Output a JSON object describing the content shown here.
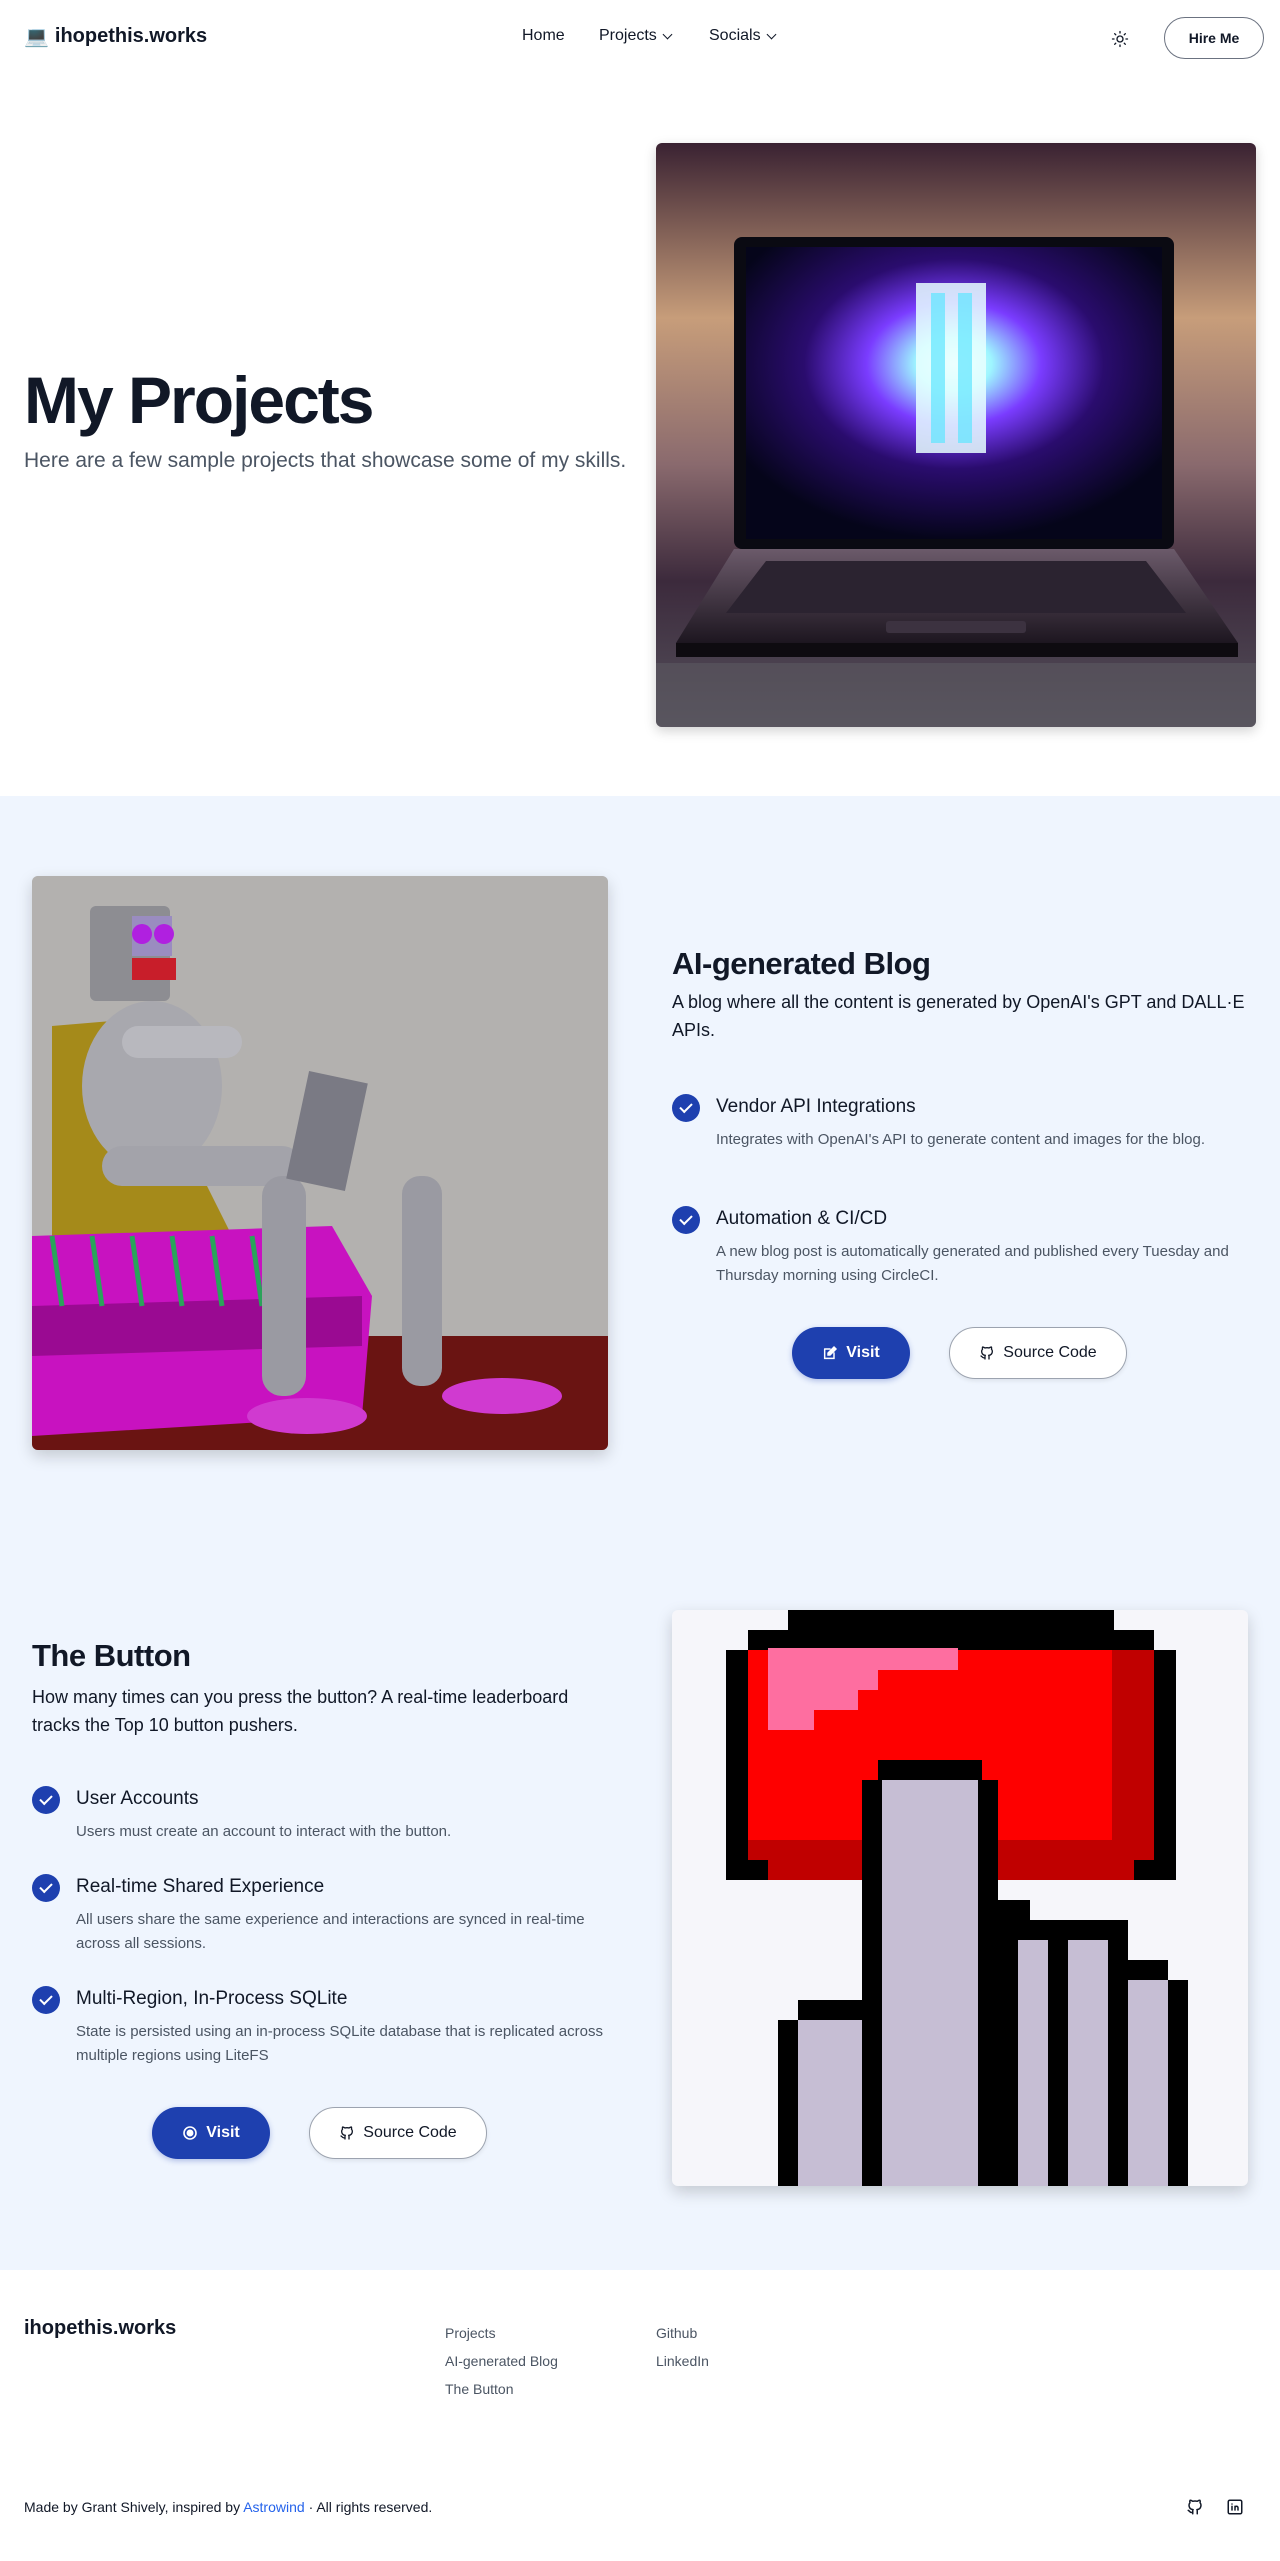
{
  "header": {
    "logo_emoji": "💻",
    "logo_text": "ihopethis.works",
    "nav": {
      "home": "Home",
      "projects": "Projects",
      "socials": "Socials"
    },
    "theme_icon": "sun-icon",
    "hire_label": "Hire Me"
  },
  "hero": {
    "title": "My Projects",
    "subtitle": "Here are a few sample projects that showcase some of my skills."
  },
  "projects": [
    {
      "title": "AI-generated Blog",
      "description": "A blog where all the content is generated by OpenAI's GPT and DALL·E APIs.",
      "features": [
        {
          "title": "Vendor API Integrations",
          "description": "Integrates with OpenAI's API to generate content and images for the blog."
        },
        {
          "title": "Automation & CI/CD",
          "description": "A new blog post is automatically generated and published every Tuesday and Thursday morning using CircleCI."
        }
      ],
      "visit_label": "Visit",
      "source_label": "Source Code"
    },
    {
      "title": "The Button",
      "description": "How many times can you press the button? A real-time leaderboard tracks the Top 10 button pushers.",
      "features": [
        {
          "title": "User Accounts",
          "description": "Users must create an account to interact with the button."
        },
        {
          "title": "Real-time Shared Experience",
          "description": "All users share the same experience and interactions are synced in real-time across all sessions."
        },
        {
          "title": "Multi-Region, In-Process SQLite",
          "description": "State is persisted using an in-process SQLite database that is replicated across multiple regions using LiteFS"
        }
      ],
      "visit_label": "Visit",
      "source_label": "Source Code"
    }
  ],
  "footer": {
    "brand": "ihopethis.works",
    "links_col1": [
      "Projects",
      "AI-generated Blog",
      "The Button"
    ],
    "links_col2": [
      "Github",
      "LinkedIn"
    ],
    "made_by": "Made by Grant Shively, inspired by",
    "astrowind": "Astrowind",
    "rights": "· All rights reserved.",
    "social_icons": [
      "github-icon",
      "linkedin-icon"
    ]
  },
  "colors": {
    "accent": "#1e40af",
    "section_bg": "#eff5fe",
    "link": "#2563eb"
  }
}
